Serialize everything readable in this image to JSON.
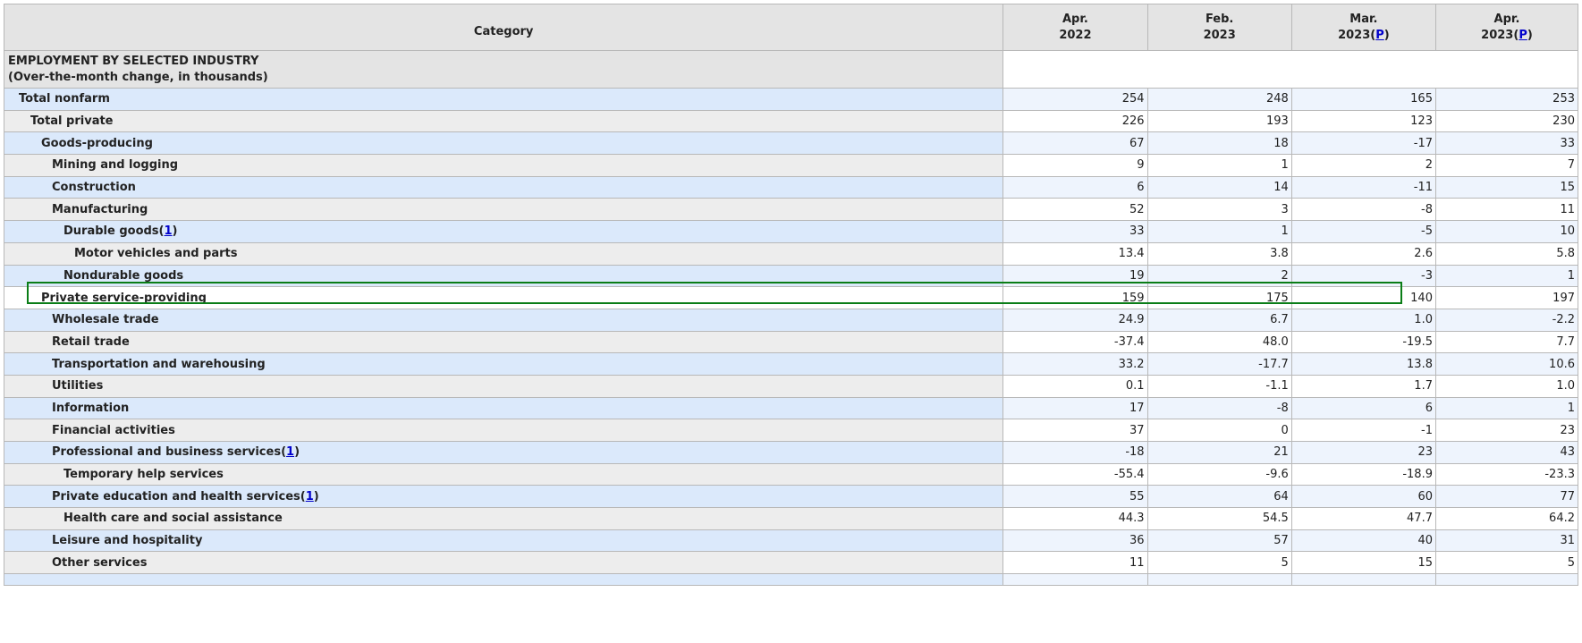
{
  "table": {
    "header": {
      "category": "Category",
      "columns": [
        {
          "line1": "Apr.",
          "line2": "2022",
          "footnote": ""
        },
        {
          "line1": "Feb.",
          "line2": "2023",
          "footnote": ""
        },
        {
          "line1": "Mar.",
          "line2": "2023",
          "footnote": "P"
        },
        {
          "line1": "Apr.",
          "line2": "2023",
          "footnote": "P"
        }
      ]
    },
    "section": {
      "title": "EMPLOYMENT BY SELECTED INDUSTRY",
      "subtitle": "(Over-the-month change, in thousands)"
    },
    "rows": [
      {
        "label": "Total nonfarm",
        "indent": 0,
        "footnote": "",
        "values": [
          "254",
          "248",
          "165",
          "253"
        ]
      },
      {
        "label": "Total private",
        "indent": 1,
        "footnote": "",
        "values": [
          "226",
          "193",
          "123",
          "230"
        ]
      },
      {
        "label": "Goods-producing",
        "indent": 2,
        "footnote": "",
        "values": [
          "67",
          "18",
          "-17",
          "33"
        ]
      },
      {
        "label": "Mining and logging",
        "indent": 3,
        "footnote": "",
        "values": [
          "9",
          "1",
          "2",
          "7"
        ]
      },
      {
        "label": "Construction",
        "indent": 3,
        "footnote": "",
        "values": [
          "6",
          "14",
          "-11",
          "15"
        ]
      },
      {
        "label": "Manufacturing",
        "indent": 3,
        "footnote": "",
        "values": [
          "52",
          "3",
          "-8",
          "11"
        ]
      },
      {
        "label": "Durable goods",
        "indent": 4,
        "footnote": "1",
        "values": [
          "33",
          "1",
          "-5",
          "10"
        ]
      },
      {
        "label": "Motor vehicles and parts",
        "indent": 5,
        "footnote": "",
        "values": [
          "13.4",
          "3.8",
          "2.6",
          "5.8"
        ]
      },
      {
        "label": "Nondurable goods",
        "indent": 4,
        "footnote": "",
        "values": [
          "19",
          "2",
          "-3",
          "1"
        ]
      },
      {
        "label": "Private service-providing",
        "indent": 2,
        "footnote": "",
        "values": [
          "159",
          "175",
          "140",
          "197"
        ]
      },
      {
        "label": "Wholesale trade",
        "indent": 3,
        "footnote": "",
        "values": [
          "24.9",
          "6.7",
          "1.0",
          "-2.2"
        ]
      },
      {
        "label": "Retail trade",
        "indent": 3,
        "footnote": "",
        "values": [
          "-37.4",
          "48.0",
          "-19.5",
          "7.7"
        ]
      },
      {
        "label": "Transportation and warehousing",
        "indent": 3,
        "footnote": "",
        "values": [
          "33.2",
          "-17.7",
          "13.8",
          "10.6"
        ]
      },
      {
        "label": "Utilities",
        "indent": 3,
        "footnote": "",
        "values": [
          "0.1",
          "-1.1",
          "1.7",
          "1.0"
        ]
      },
      {
        "label": "Information",
        "indent": 3,
        "footnote": "",
        "values": [
          "17",
          "-8",
          "6",
          "1"
        ]
      },
      {
        "label": "Financial activities",
        "indent": 3,
        "footnote": "",
        "values": [
          "37",
          "0",
          "-1",
          "23"
        ]
      },
      {
        "label": "Professional and business services",
        "indent": 3,
        "footnote": "1",
        "values": [
          "-18",
          "21",
          "23",
          "43"
        ]
      },
      {
        "label": "Temporary help services",
        "indent": 4,
        "footnote": "",
        "values": [
          "-55.4",
          "-9.6",
          "-18.9",
          "-23.3"
        ]
      },
      {
        "label": "Private education and health services",
        "indent": 3,
        "footnote": "1",
        "values": [
          "55",
          "64",
          "60",
          "77"
        ]
      },
      {
        "label": "Health care and social assistance",
        "indent": 4,
        "footnote": "",
        "values": [
          "44.3",
          "54.5",
          "47.7",
          "64.2"
        ]
      },
      {
        "label": "Leisure and hospitality",
        "indent": 3,
        "footnote": "",
        "values": [
          "36",
          "57",
          "40",
          "31"
        ]
      },
      {
        "label": "Other services",
        "indent": 3,
        "footnote": "",
        "values": [
          "11",
          "5",
          "15",
          "5"
        ]
      }
    ],
    "highlighted_row": "Private service-providing"
  },
  "colors": {
    "header_bg": "#e4e4e4",
    "row_blue_label": "#dbe9fb",
    "row_blue_value": "#eef4fd",
    "row_gray_label": "#ededed",
    "link": "#0000cc",
    "highlight_border": "#0a7d17"
  }
}
